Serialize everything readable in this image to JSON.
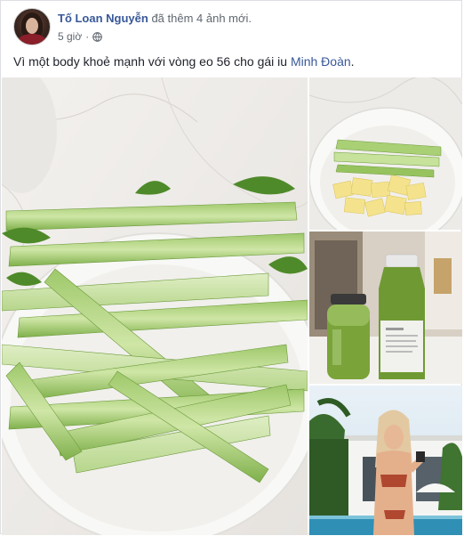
{
  "post": {
    "author_name": "Tố Loan Nguyễn",
    "action_text": " đã thêm 4 ảnh mới.",
    "timestamp": "5 giờ",
    "separator": "·",
    "privacy_icon": "globe-icon",
    "caption_text": "Vì một body khoẻ mạnh với vòng eo 56 cho gái iu ",
    "caption_mention": "Minh Đoàn",
    "caption_end": "."
  },
  "photos": [
    {
      "name": "celery-bowl-photo"
    },
    {
      "name": "celery-and-apple-photo"
    },
    {
      "name": "green-juice-bottles-photo"
    },
    {
      "name": "woman-poolside-photo"
    }
  ],
  "colors": {
    "link": "#385898",
    "meta": "#606770",
    "text": "#1d2129",
    "border": "#dddfe2"
  }
}
